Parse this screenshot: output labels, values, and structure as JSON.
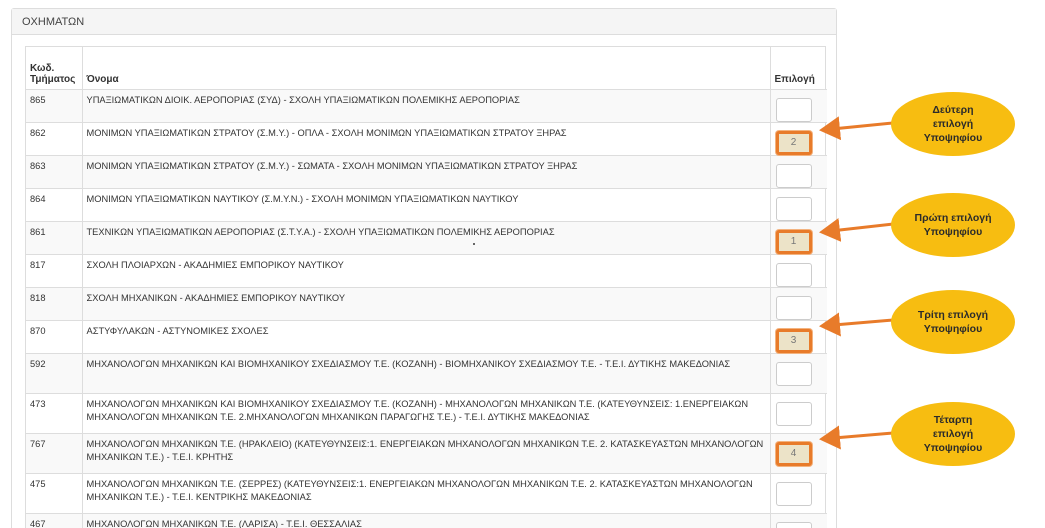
{
  "panel": {
    "title": "ΟΧΗΜΑΤΩΝ"
  },
  "table": {
    "headers": {
      "code": "Κωδ. Τμήματος",
      "name": "Όνομα",
      "choice": "Επιλογή"
    },
    "rows": [
      {
        "code": "865",
        "name": "ΥΠΑΞΙΩΜΑΤΙΚΩΝ ΔΙΟΙΚ. ΑΕΡΟΠΟΡΙΑΣ (ΣΥΔ) - ΣΧΟΛΗ ΥΠΑΞΙΩΜΑΤΙΚΩΝ ΠΟΛΕΜΙΚΗΣ ΑΕΡΟΠΟΡΙΑΣ",
        "choice": ""
      },
      {
        "code": "862",
        "name": "ΜΟΝΙΜΩΝ ΥΠΑΞΙΩΜΑΤΙΚΩΝ ΣΤΡΑΤΟΥ (Σ.Μ.Υ.) - ΟΠΛΑ - ΣΧΟΛΗ ΜΟΝΙΜΩΝ ΥΠΑΞΙΩΜΑΤΙΚΩΝ ΣΤΡΑΤΟΥ ΞΗΡΑΣ",
        "choice": "2"
      },
      {
        "code": "863",
        "name": "ΜΟΝΙΜΩΝ ΥΠΑΞΙΩΜΑΤΙΚΩΝ ΣΤΡΑΤΟΥ (Σ.Μ.Υ.) - ΣΩΜΑΤΑ - ΣΧΟΛΗ ΜΟΝΙΜΩΝ ΥΠΑΞΙΩΜΑΤΙΚΩΝ ΣΤΡΑΤΟΥ ΞΗΡΑΣ",
        "choice": ""
      },
      {
        "code": "864",
        "name": "ΜΟΝΙΜΩΝ ΥΠΑΞΙΩΜΑΤΙΚΩΝ ΝΑΥΤΙΚΟΥ (Σ.Μ.Υ.Ν.) - ΣΧΟΛΗ ΜΟΝΙΜΩΝ ΥΠΑΞΙΩΜΑΤΙΚΩΝ ΝΑΥΤΙΚΟΥ",
        "choice": ""
      },
      {
        "code": "861",
        "name": "ΤΕΧΝΙΚΩΝ ΥΠΑΞΙΩΜΑΤΙΚΩΝ ΑΕΡΟΠΟΡΙΑΣ (Σ.Τ.Υ.Α.) - ΣΧΟΛΗ ΥΠΑΞΙΩΜΑΤΙΚΩΝ ΠΟΛΕΜΙΚΗΣ ΑΕΡΟΠΟΡΙΑΣ",
        "choice": "1"
      },
      {
        "code": "817",
        "name": "ΣΧΟΛΗ ΠΛΟΙΑΡΧΩΝ - ΑΚΑΔΗΜΙΕΣ ΕΜΠΟΡΙΚΟΥ ΝΑΥΤΙΚΟΥ",
        "choice": ""
      },
      {
        "code": "818",
        "name": "ΣΧΟΛΗ ΜΗΧΑΝΙΚΩΝ - ΑΚΑΔΗΜΙΕΣ ΕΜΠΟΡΙΚΟΥ ΝΑΥΤΙΚΟΥ",
        "choice": ""
      },
      {
        "code": "870",
        "name": "ΑΣΤΥΦΥΛΑΚΩΝ - ΑΣΤΥΝΟΜΙΚΕΣ ΣΧΟΛΕΣ",
        "choice": "3"
      },
      {
        "code": "592",
        "name": "ΜΗΧΑΝΟΛΟΓΩΝ ΜΗΧΑΝΙΚΩΝ ΚΑΙ ΒΙΟΜΗΧΑΝΙΚΟΥ ΣΧΕΔΙΑΣΜΟΥ Τ.Ε. (ΚΟΖΑΝΗ) - ΒΙΟΜΗΧΑΝΙΚΟΥ ΣΧΕΔΙΑΣΜΟΥ Τ.Ε. - Τ.Ε.Ι. ΔΥΤΙΚΗΣ ΜΑΚΕΔΟΝΙΑΣ",
        "choice": ""
      },
      {
        "code": "473",
        "name": "ΜΗΧΑΝΟΛΟΓΩΝ ΜΗΧΑΝΙΚΩΝ ΚΑΙ ΒΙΟΜΗΧΑΝΙΚΟΥ ΣΧΕΔΙΑΣΜΟΥ Τ.Ε. (ΚΟΖΑΝΗ) - ΜΗΧΑΝΟΛΟΓΩΝ ΜΗΧΑΝΙΚΩΝ Τ.Ε. (ΚΑΤΕΥΘΥΝΣΕΙΣ: 1.ΕΝΕΡΓΕΙΑΚΩΝ ΜΗΧΑΝΟΛΟΓΩΝ ΜΗΧΑΝΙΚΩΝ Τ.Ε. 2.ΜΗΧΑΝΟΛΟΓΩΝ ΜΗΧΑΝΙΚΩΝ ΠΑΡΑΓΩΓΗΣ Τ.Ε.) - Τ.Ε.Ι. ΔΥΤΙΚΗΣ ΜΑΚΕΔΟΝΙΑΣ",
        "choice": ""
      },
      {
        "code": "767",
        "name": "ΜΗΧΑΝΟΛΟΓΩΝ ΜΗΧΑΝΙΚΩΝ Τ.Ε. (ΗΡΑΚΛΕΙΟ) (ΚΑΤΕΥΘΥΝΣΕΙΣ:1. ΕΝΕΡΓΕΙΑΚΩΝ ΜΗΧΑΝΟΛΟΓΩΝ ΜΗΧΑΝΙΚΩΝ Τ.Ε. 2. ΚΑΤΑΣΚΕΥΑΣΤΩΝ ΜΗΧΑΝΟΛΟΓΩΝ ΜΗΧΑΝΙΚΩΝ Τ.Ε.) - Τ.Ε.Ι. ΚΡΗΤΗΣ",
        "choice": "4"
      },
      {
        "code": "475",
        "name": "ΜΗΧΑΝΟΛΟΓΩΝ ΜΗΧΑΝΙΚΩΝ Τ.Ε. (ΣΕΡΡΕΣ) (ΚΑΤΕΥΘΥΝΣΕΙΣ:1. ΕΝΕΡΓΕΙΑΚΩΝ ΜΗΧΑΝΟΛΟΓΩΝ ΜΗΧΑΝΙΚΩΝ Τ.Ε. 2. ΚΑΤΑΣΚΕΥΑΣΤΩΝ ΜΗΧΑΝΟΛΟΓΩΝ ΜΗΧΑΝΙΚΩΝ Τ.Ε.) - Τ.Ε.Ι. ΚΕΝΤΡΙΚΗΣ ΜΑΚΕΔΟΝΙΑΣ",
        "choice": ""
      },
      {
        "code": "467",
        "name": "ΜΗΧΑΝΟΛΟΓΩΝ ΜΗΧΑΝΙΚΩΝ Τ.Ε. (ΛΑΡΙΣΑ) - Τ.Ε.Ι. ΘΕΣΣΑΛΙΑΣ",
        "choice": ""
      }
    ]
  },
  "callouts": {
    "second": "Δεύτερη\nεπιλογή\nΥποψηφίου",
    "first": "Πρώτη επιλογή\nΥποψηφίου",
    "third": "Τρίτη επιλογή\nΥποψηφίου",
    "fourth": "Τέταρτη\nεπιλογή\nΥποψηφίου"
  },
  "colors": {
    "callout_fill": "#f7bd11",
    "arrow": "#e87b2a",
    "filled_choice_bg": "#ece3c8"
  }
}
